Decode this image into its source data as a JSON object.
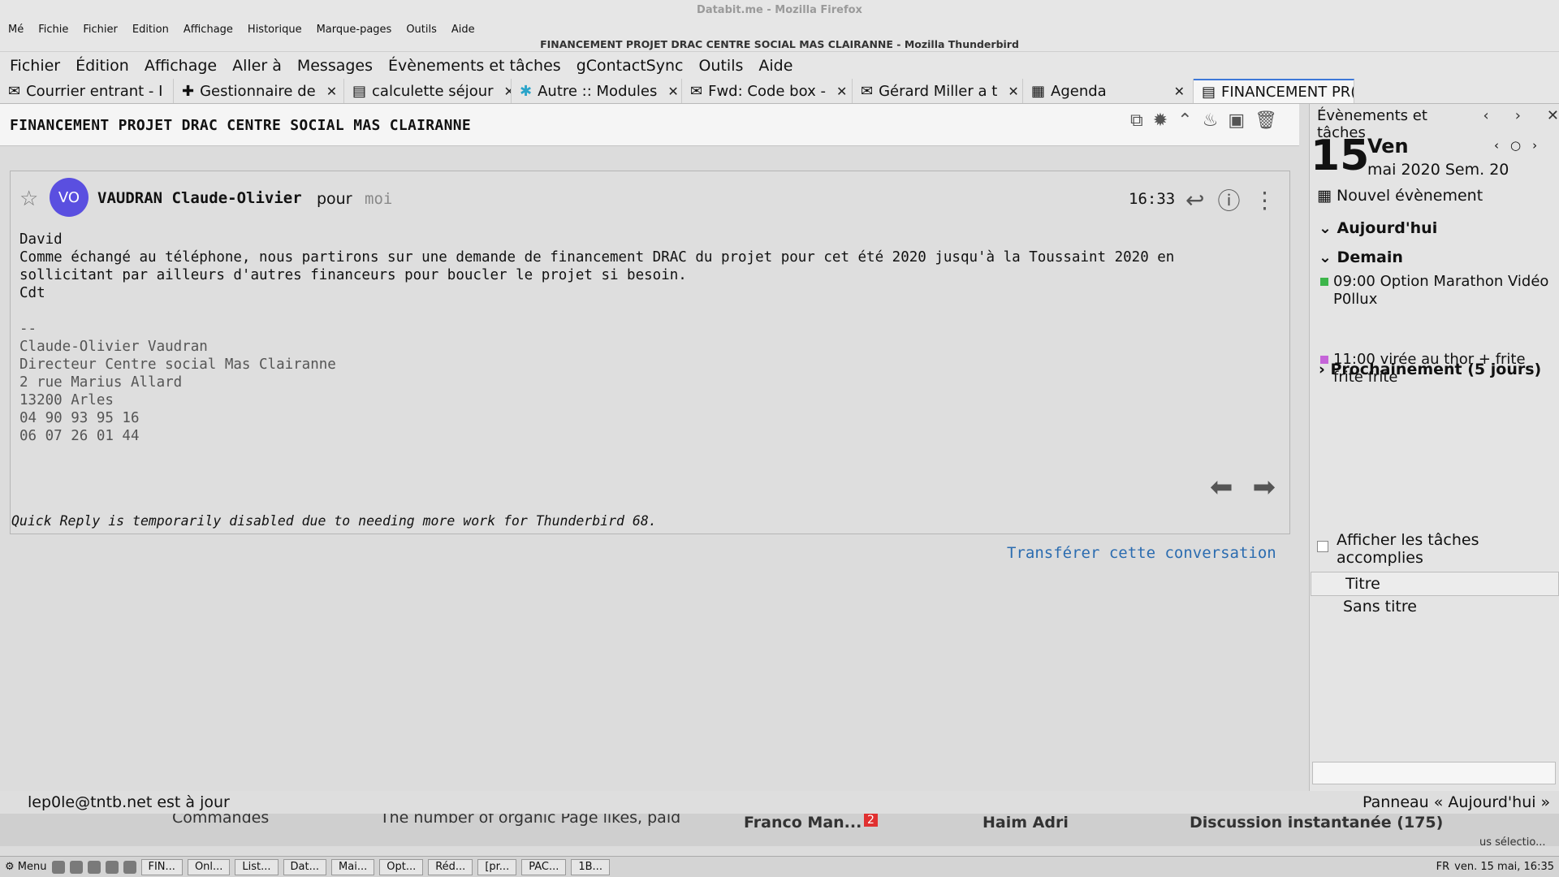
{
  "firefox": {
    "title": "Databit.me - Mozilla Firefox",
    "menu": [
      "Mé",
      "Fichie",
      "Fichier",
      "Edition",
      "Affichage",
      "Historique",
      "Marque-pages",
      "Outils",
      "Aide"
    ]
  },
  "thunderbird": {
    "title": "FINANCEMENT PROJET DRAC CENTRE SOCIAL MAS CLAIRANNE - Mozilla Thunderbird",
    "menu": [
      "Fichier",
      "Édition",
      "Affichage",
      "Aller à",
      "Messages",
      "Évènements et tâches",
      "gContactSync",
      "Outils",
      "Aide"
    ]
  },
  "tabs": [
    {
      "label": "Courrier entrant - I"
    },
    {
      "label": "Gestionnaire de"
    },
    {
      "label": "calculette séjour"
    },
    {
      "label": "Autre :: Modules"
    },
    {
      "label": "Fwd: Code box -"
    },
    {
      "label": "Gérard Miller a t"
    },
    {
      "label": "Agenda"
    },
    {
      "label": "FINANCEMENT PR("
    }
  ],
  "message": {
    "subject": "FINANCEMENT PROJET DRAC CENTRE SOCIAL MAS CLAIRANNE",
    "avatar_initials": "VO",
    "sender": "VAUDRAN Claude-Olivier",
    "pour": "pour",
    "recipient": "moi",
    "time": "16:33",
    "body": "David\nComme échangé au téléphone, nous partirons sur une demande de financement DRAC du projet pour cet été 2020 jusqu'à la Toussaint 2020 en\nsollicitant par ailleurs d'autres financeurs pour boucler le projet si besoin.\nCdt",
    "signature": "--\nClaude-Olivier Vaudran\nDirecteur Centre social Mas Clairanne\n2 rue Marius Allard\n13200 Arles\n04 90 93 95 16\n06 07 26 01 44",
    "quick_reply_note": "Quick Reply is temporarily disabled due to needing more work for Thunderbird 68.",
    "forward_link": "Transférer cette conversation"
  },
  "sidebar": {
    "header": "Évènements et tâches",
    "day_number": "15",
    "day_name": "Ven",
    "month_week": "mai 2020 Sem. 20",
    "new_event": "Nouvel évènement",
    "today": "Aujourd'hui",
    "tomorrow": "Demain",
    "events": [
      {
        "text": "09:00 Option Marathon Vidéo P0llux",
        "color": "#3cb54a"
      },
      {
        "text": "11:00 virée au thor + frite frite frite",
        "color": "#c564d8"
      }
    ],
    "upcoming": "Prochainement (5 jours)",
    "show_done_tasks": "Afficher les tâches accomplies",
    "task_column": "Titre",
    "task_row": "Sans titre"
  },
  "status": {
    "left": "lep0le@tntb.net est à jour",
    "right": "Panneau « Aujourd'hui »"
  },
  "background_strip": {
    "item1": "Commandes",
    "item2": "The number of organic Page likes, paid",
    "chat1": "Franco Man...",
    "chat1_badge": "2",
    "chat2": "Haim Adri",
    "chat3": "Discussion instantanée (175)",
    "item3": "us sélectio..."
  },
  "taskbar": {
    "menu": "Menu",
    "windows": [
      "FIN...",
      "Onl...",
      "List...",
      "Dat...",
      "Mai...",
      "Opt...",
      "Réd...",
      "[pr...",
      "PAC...",
      "1B..."
    ],
    "lang": "FR",
    "clock": "ven. 15 mai, 16:35"
  }
}
